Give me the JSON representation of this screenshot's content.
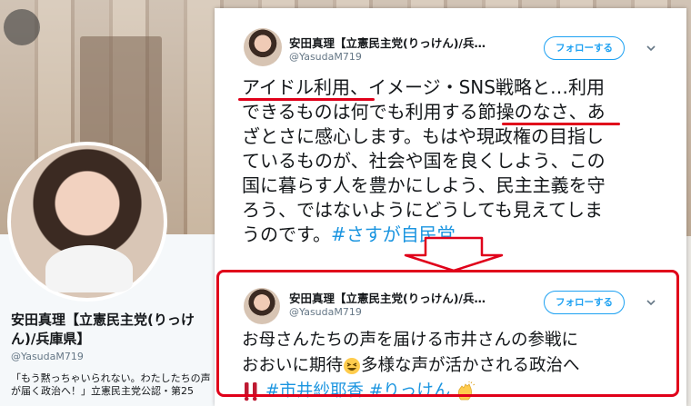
{
  "profile": {
    "name": "安田真理【立憲民主党(りっけん)/兵庫県】",
    "handle": "@YasudaM719",
    "bio": "「もう黙っちゃいられない。わたしたちの声が届く政治へ！」立憲民主党公認・第25"
  },
  "tweet1": {
    "author": "安田真理【立憲民主党(りっけん)/兵…",
    "handle": "@YasudaM719",
    "follow_label": "フォローする",
    "text_lines": [
      "アイドル利用、イメージ・SNS戦略と…利用",
      "できるものは何でも利用する節操のなさ、あ",
      "ざとさに感心します。もはや現政権の目指し",
      "ているものが、社会や国を良くしよう、この",
      "国に暮らす人を豊かにしよう、民主主義を守",
      "ろう、ではないようにどうしても見えてしま",
      "うのです。"
    ],
    "hashtag": "#さすが自民党"
  },
  "tweet2": {
    "author": "安田真理【立憲民主党(りっけん)/兵…",
    "handle": "@YasudaM719",
    "follow_label": "フォローする",
    "line1": "お母さんたちの声を届ける市井さんの参戦に",
    "line2a": "おおいに期待",
    "line2b": "多様な声が活かされる政治へ",
    "hashtag1": "#市井紗耶香",
    "hashtag2": "#りっけん"
  },
  "colors": {
    "accent": "#1da1f2",
    "hashtag": "#1b95e0",
    "annotation_red": "#e0001a"
  }
}
